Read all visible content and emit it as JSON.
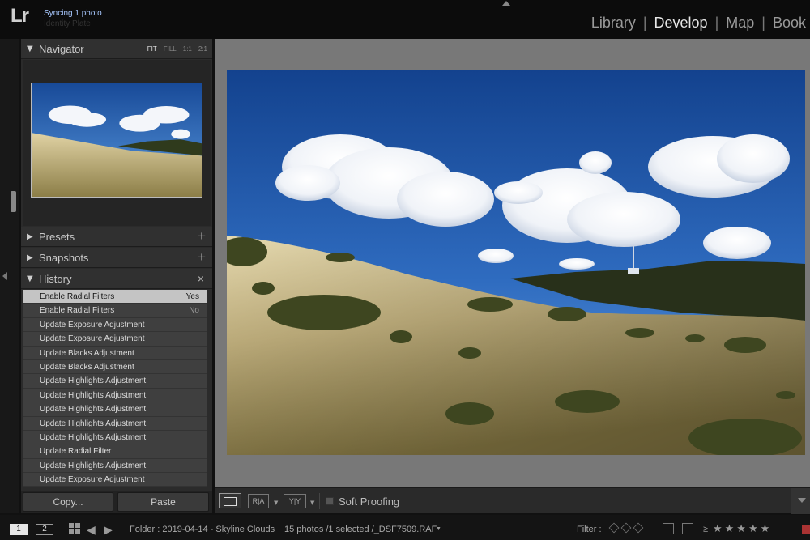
{
  "app": {
    "logo": "Lr",
    "sync_status": "Syncing 1 photo",
    "sync_sub": "Identity Plate"
  },
  "modules": [
    {
      "label": "Library",
      "active": false
    },
    {
      "label": "Develop",
      "active": true
    },
    {
      "label": "Map",
      "active": false
    },
    {
      "label": "Book",
      "active": false
    }
  ],
  "module_separator": "|",
  "navigator": {
    "title": "Navigator",
    "options": [
      "FIT",
      "FILL",
      "1:1",
      "2:1"
    ],
    "active_option": "FIT"
  },
  "presets": {
    "title": "Presets",
    "action": "+"
  },
  "snapshots": {
    "title": "Snapshots",
    "action": "+"
  },
  "history": {
    "title": "History",
    "close": "×",
    "items": [
      {
        "label": "Enable Radial Filters",
        "value": "Yes",
        "selected": true
      },
      {
        "label": "Enable Radial Filters",
        "value": "No",
        "selected": false
      },
      {
        "label": "Update Exposure Adjustment",
        "value": "",
        "selected": false
      },
      {
        "label": "Update Exposure Adjustment",
        "value": "",
        "selected": false
      },
      {
        "label": "Update Blacks Adjustment",
        "value": "",
        "selected": false
      },
      {
        "label": "Update Blacks Adjustment",
        "value": "",
        "selected": false
      },
      {
        "label": "Update Highlights Adjustment",
        "value": "",
        "selected": false
      },
      {
        "label": "Update Highlights Adjustment",
        "value": "",
        "selected": false
      },
      {
        "label": "Update Highlights Adjustment",
        "value": "",
        "selected": false
      },
      {
        "label": "Update Highlights Adjustment",
        "value": "",
        "selected": false
      },
      {
        "label": "Update Highlights Adjustment",
        "value": "",
        "selected": false
      },
      {
        "label": "Update Radial Filter",
        "value": "",
        "selected": false
      },
      {
        "label": "Update Highlights Adjustment",
        "value": "",
        "selected": false
      },
      {
        "label": "Update Exposure Adjustment",
        "value": "",
        "selected": false
      }
    ]
  },
  "buttons": {
    "copy": "Copy...",
    "paste": "Paste"
  },
  "toolbar": {
    "ra_label": "R|A",
    "yy_label": "Y|Y",
    "soft_proofing": "Soft Proofing"
  },
  "filmstrip": {
    "screen1": "1",
    "screen2": "2",
    "folder": "Folder : 2019-04-14 - Skyline Clouds",
    "count": "15 photos /1 selected /_DSF7509.RAF",
    "filter_label": "Filter :",
    "rating_prefix": "≥",
    "stars": "★★★★★"
  },
  "colors": {
    "sky_top": "#1d4f9e",
    "sky_bottom": "#4f8fd8",
    "grass": "#c8b680",
    "selected_row": "#c4c4c4"
  }
}
